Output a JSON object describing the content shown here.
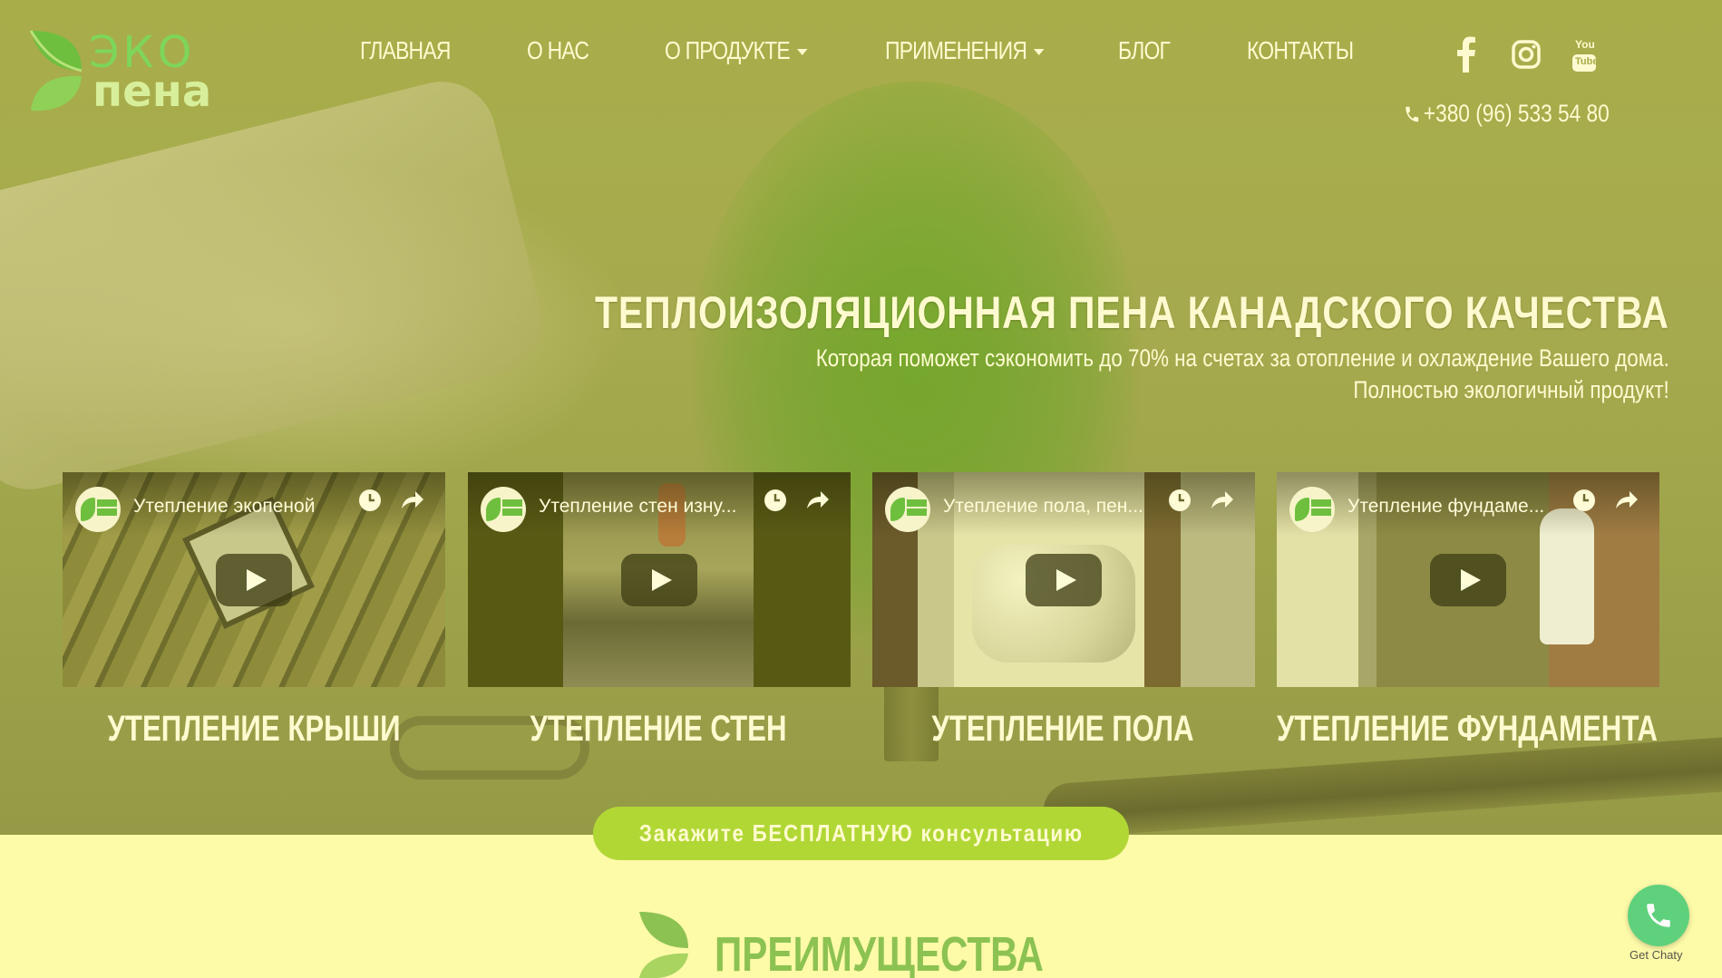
{
  "brand": {
    "line1": "ЭКО",
    "line2": "пена",
    "leaf_color": "#6fbf3f"
  },
  "nav": {
    "items": [
      {
        "label": "ГЛАВНАЯ",
        "has_dropdown": false
      },
      {
        "label": "О НАС",
        "has_dropdown": false
      },
      {
        "label": "О ПРОДУКТЕ",
        "has_dropdown": true
      },
      {
        "label": "ПРИМЕНЕНИЯ",
        "has_dropdown": true
      },
      {
        "label": "БЛОГ",
        "has_dropdown": false
      },
      {
        "label": "КОНТАКТЫ",
        "has_dropdown": false
      }
    ]
  },
  "social": {
    "icons": [
      "facebook-icon",
      "instagram-icon",
      "youtube-icon"
    ],
    "youtube_text_1": "You",
    "youtube_text_2": "Tube"
  },
  "contact": {
    "phone": "+380 (96) 533 54 80"
  },
  "hero": {
    "title": "ТЕПЛОИЗОЛЯЦИОННАЯ ПЕНА КАНАДСКОГО КАЧЕСТВА",
    "subtitle_line1": "Которая поможет сэкономить до 70% на счетах за отопление и охлаждение Вашего дома.",
    "subtitle_line2": "Полностью экологичный продукт!"
  },
  "videos": [
    {
      "video_title": "Утепление экопеной",
      "caption": "УТЕПЛЕНИЕ КРЫШИ"
    },
    {
      "video_title": "Утепление стен изну...",
      "caption": "УТЕПЛЕНИЕ СТЕН"
    },
    {
      "video_title": "Утепление пола, пен...",
      "caption": "УТЕПЛЕНИЕ ПОЛА"
    },
    {
      "video_title": "Утепление фундаме...",
      "caption": "УТЕПЛЕНИЕ ФУНДАМЕНТА"
    }
  ],
  "cta": {
    "label": "Закажите БЕСПЛАТНУЮ консультацию"
  },
  "advantages": {
    "title": "ПРЕИМУЩЕСТВА"
  },
  "chaty": {
    "label": "Get Chaty"
  },
  "colors": {
    "accent": "#b1d735",
    "header_text": "#fffbd0",
    "section_title": "#8cc252",
    "page_bg": "#fdfaa8",
    "chat_button": "#5fd17d"
  }
}
